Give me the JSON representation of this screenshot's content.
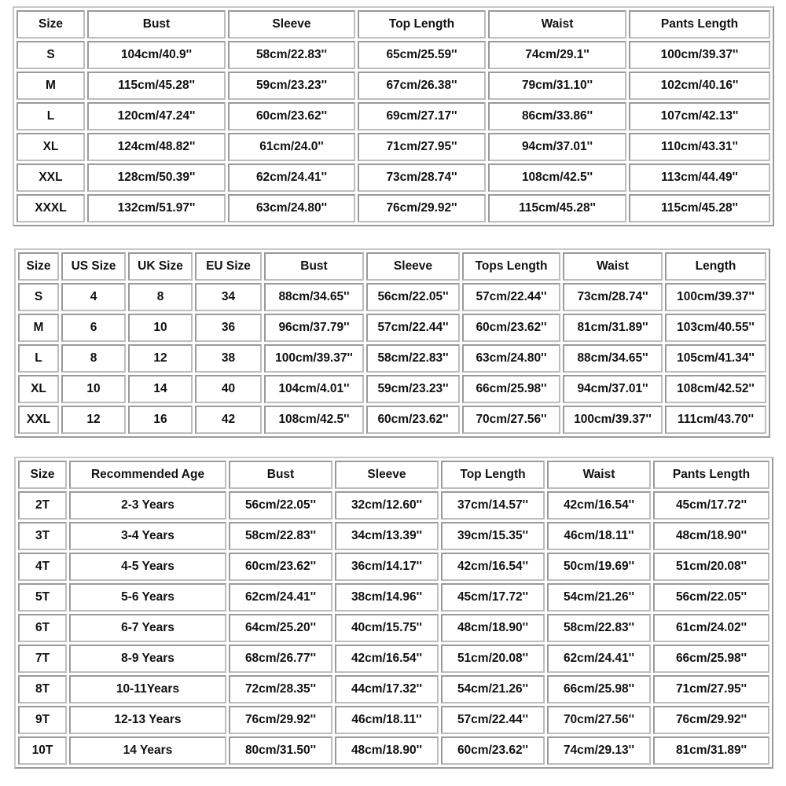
{
  "table1": {
    "headers": [
      "Size",
      "Bust",
      "Sleeve",
      "Top Length",
      "Waist",
      "Pants Length"
    ],
    "rows": [
      [
        "S",
        "104cm/40.9''",
        "58cm/22.83''",
        "65cm/25.59''",
        "74cm/29.1''",
        "100cm/39.37''"
      ],
      [
        "M",
        "115cm/45.28''",
        "59cm/23.23''",
        "67cm/26.38''",
        "79cm/31.10''",
        "102cm/40.16''"
      ],
      [
        "L",
        "120cm/47.24''",
        "60cm/23.62''",
        "69cm/27.17''",
        "86cm/33.86''",
        "107cm/42.13''"
      ],
      [
        "XL",
        "124cm/48.82''",
        "61cm/24.0''",
        "71cm/27.95''",
        "94cm/37.01''",
        "110cm/43.31''"
      ],
      [
        "XXL",
        "128cm/50.39''",
        "62cm/24.41''",
        "73cm/28.74''",
        "108cm/42.5''",
        "113cm/44.49''"
      ],
      [
        "XXXL",
        "132cm/51.97''",
        "63cm/24.80''",
        "76cm/29.92''",
        "115cm/45.28''",
        "115cm/45.28''"
      ]
    ]
  },
  "table2": {
    "headers": [
      "Size",
      "US Size",
      "UK Size",
      "EU Size",
      "Bust",
      "Sleeve",
      "Tops Length",
      "Waist",
      "Length"
    ],
    "rows": [
      [
        "S",
        "4",
        "8",
        "34",
        "88cm/34.65''",
        "56cm/22.05''",
        "57cm/22.44''",
        "73cm/28.74''",
        "100cm/39.37''"
      ],
      [
        "M",
        "6",
        "10",
        "36",
        "96cm/37.79''",
        "57cm/22.44''",
        "60cm/23.62''",
        "81cm/31.89''",
        "103cm/40.55''"
      ],
      [
        "L",
        "8",
        "12",
        "38",
        "100cm/39.37''",
        "58cm/22.83''",
        "63cm/24.80''",
        "88cm/34.65''",
        "105cm/41.34''"
      ],
      [
        "XL",
        "10",
        "14",
        "40",
        "104cm/4.01''",
        "59cm/23.23''",
        "66cm/25.98''",
        "94cm/37.01''",
        "108cm/42.52''"
      ],
      [
        "XXL",
        "12",
        "16",
        "42",
        "108cm/42.5''",
        "60cm/23.62''",
        "70cm/27.56''",
        "100cm/39.37''",
        "111cm/43.70''"
      ]
    ]
  },
  "table3": {
    "headers": [
      "Size",
      "Recommended Age",
      "Bust",
      "Sleeve",
      "Top Length",
      "Waist",
      "Pants Length"
    ],
    "rows": [
      [
        "2T",
        "2-3 Years",
        "56cm/22.05''",
        "32cm/12.60''",
        "37cm/14.57''",
        "42cm/16.54''",
        "45cm/17.72''"
      ],
      [
        "3T",
        "3-4 Years",
        "58cm/22.83''",
        "34cm/13.39''",
        "39cm/15.35''",
        "46cm/18.11''",
        "48cm/18.90''"
      ],
      [
        "4T",
        "4-5 Years",
        "60cm/23.62''",
        "36cm/14.17''",
        "42cm/16.54''",
        "50cm/19.69''",
        "51cm/20.08''"
      ],
      [
        "5T",
        "5-6 Years",
        "62cm/24.41''",
        "38cm/14.96''",
        "45cm/17.72''",
        "54cm/21.26''",
        "56cm/22.05''"
      ],
      [
        "6T",
        "6-7 Years",
        "64cm/25.20''",
        "40cm/15.75''",
        "48cm/18.90''",
        "58cm/22.83''",
        "61cm/24.02''"
      ],
      [
        "7T",
        "8-9 Years",
        "68cm/26.77''",
        "42cm/16.54''",
        "51cm/20.08''",
        "62cm/24.41''",
        "66cm/25.98''"
      ],
      [
        "8T",
        "10-11Years",
        "72cm/28.35''",
        "44cm/17.32''",
        "54cm/21.26''",
        "66cm/25.98''",
        "71cm/27.95''"
      ],
      [
        "9T",
        "12-13 Years",
        "76cm/29.92''",
        "46cm/18.11''",
        "57cm/22.44''",
        "70cm/27.56''",
        "76cm/29.92''"
      ],
      [
        "10T",
        "14 Years",
        "80cm/31.50''",
        "48cm/18.90''",
        "60cm/23.62''",
        "74cm/29.13''",
        "81cm/31.89''"
      ]
    ]
  }
}
